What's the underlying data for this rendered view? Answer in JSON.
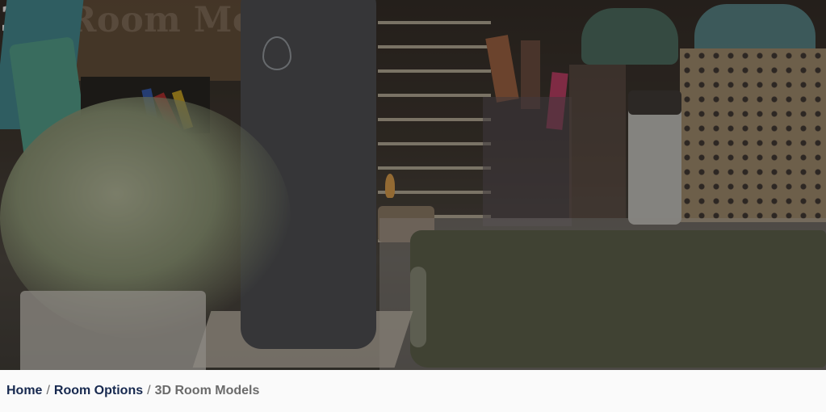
{
  "hero": {
    "title": "3D Room Models"
  },
  "breadcrumb": {
    "items": [
      {
        "label": "Home",
        "is_link": true
      },
      {
        "label": "Room Options",
        "is_link": true
      },
      {
        "label": "3D Room Models",
        "is_link": false
      }
    ],
    "separator": "/"
  },
  "colors": {
    "link": "#17294f",
    "current": "#6b6b6b",
    "title": "#ffffff"
  }
}
